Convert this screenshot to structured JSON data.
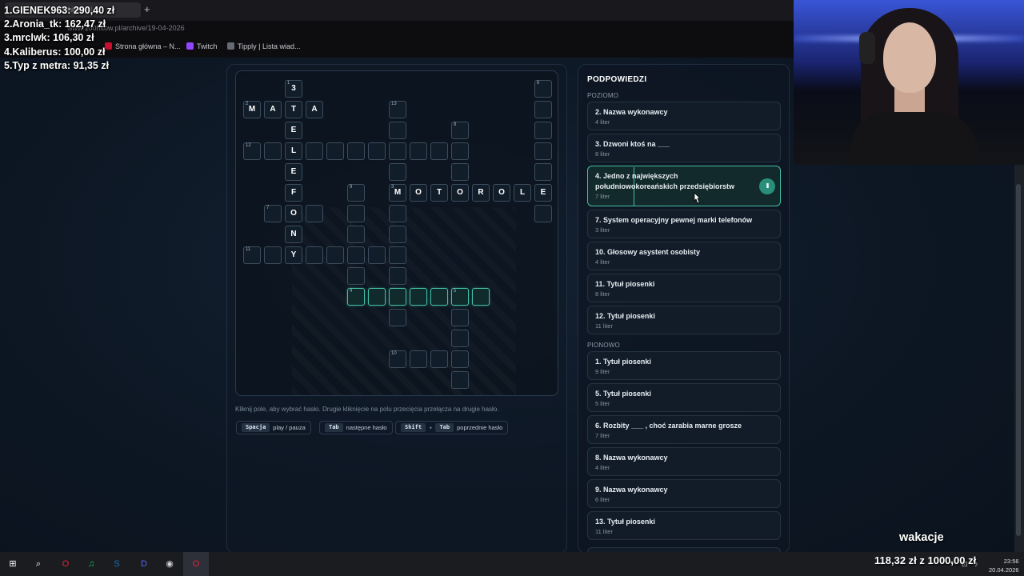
{
  "browser": {
    "tab_title": "100hitów.pl",
    "new_tab": "+",
    "url": "www.100hitow.pl/archive/19-04-2026",
    "bookmarks": [
      {
        "label": "Strona główna – N...",
        "color": "#c8102e"
      },
      {
        "label": "Twitch",
        "color": "#9146ff"
      },
      {
        "label": "Tipply | Lista wiad...",
        "color": "#666a72"
      }
    ]
  },
  "donors": [
    "1.GIENEK963: 290,40 zł",
    "2.Aronia_tk: 162,47 zł",
    "3.mrclwk: 106,30 zł",
    "4.Kaliberus: 100,00 zł",
    "5.Typ z metra: 91,35 zł"
  ],
  "crossword": {
    "help": "Kliknij pole, aby wybrać hasło. Drugie kliknięcie na polu przecięcia przełącza na drugie hasło.",
    "shortcuts": [
      {
        "keys": [
          "Spacja"
        ],
        "desc": "play / pauza"
      },
      {
        "keys": [
          "Tab"
        ],
        "desc": "następne hasło"
      },
      {
        "keys": [
          "Shift",
          "Tab"
        ],
        "desc": "poprzednie hasło"
      }
    ],
    "cells": [
      {
        "r": 0,
        "c": 2,
        "n": "1",
        "l": "3"
      },
      {
        "r": 0,
        "c": 14,
        "n": "6",
        "l": ""
      },
      {
        "r": 1,
        "c": 0,
        "n": "2",
        "l": "M"
      },
      {
        "r": 1,
        "c": 1,
        "n": "",
        "l": "A"
      },
      {
        "r": 1,
        "c": 2,
        "n": "",
        "l": "T"
      },
      {
        "r": 1,
        "c": 3,
        "n": "",
        "l": "A"
      },
      {
        "r": 1,
        "c": 7,
        "n": "13",
        "l": ""
      },
      {
        "r": 1,
        "c": 14,
        "n": "",
        "l": ""
      },
      {
        "r": 2,
        "c": 2,
        "n": "",
        "l": "E"
      },
      {
        "r": 2,
        "c": 7,
        "n": "",
        "l": ""
      },
      {
        "r": 2,
        "c": 10,
        "n": "8",
        "l": ""
      },
      {
        "r": 2,
        "c": 14,
        "n": "",
        "l": ""
      },
      {
        "r": 3,
        "c": 0,
        "n": "12",
        "l": ""
      },
      {
        "r": 3,
        "c": 1,
        "n": "",
        "l": ""
      },
      {
        "r": 3,
        "c": 2,
        "n": "",
        "l": "L"
      },
      {
        "r": 3,
        "c": 3,
        "n": "",
        "l": ""
      },
      {
        "r": 3,
        "c": 4,
        "n": "",
        "l": ""
      },
      {
        "r": 3,
        "c": 5,
        "n": "",
        "l": ""
      },
      {
        "r": 3,
        "c": 6,
        "n": "",
        "l": ""
      },
      {
        "r": 3,
        "c": 7,
        "n": "",
        "l": ""
      },
      {
        "r": 3,
        "c": 8,
        "n": "",
        "l": ""
      },
      {
        "r": 3,
        "c": 9,
        "n": "",
        "l": ""
      },
      {
        "r": 3,
        "c": 10,
        "n": "",
        "l": ""
      },
      {
        "r": 3,
        "c": 14,
        "n": "",
        "l": ""
      },
      {
        "r": 4,
        "c": 2,
        "n": "",
        "l": "E"
      },
      {
        "r": 4,
        "c": 7,
        "n": "",
        "l": ""
      },
      {
        "r": 4,
        "c": 10,
        "n": "",
        "l": ""
      },
      {
        "r": 4,
        "c": 14,
        "n": "",
        "l": ""
      },
      {
        "r": 5,
        "c": 2,
        "n": "",
        "l": "F"
      },
      {
        "r": 5,
        "c": 5,
        "n": "9",
        "l": ""
      },
      {
        "r": 5,
        "c": 7,
        "n": "3",
        "l": "M"
      },
      {
        "r": 5,
        "c": 8,
        "n": "",
        "l": "O"
      },
      {
        "r": 5,
        "c": 9,
        "n": "",
        "l": "T"
      },
      {
        "r": 5,
        "c": 10,
        "n": "",
        "l": "O"
      },
      {
        "r": 5,
        "c": 11,
        "n": "",
        "l": "R"
      },
      {
        "r": 5,
        "c": 12,
        "n": "",
        "l": "O"
      },
      {
        "r": 5,
        "c": 13,
        "n": "",
        "l": "L"
      },
      {
        "r": 5,
        "c": 14,
        "n": "",
        "l": "E"
      },
      {
        "r": 6,
        "c": 1,
        "n": "7",
        "l": ""
      },
      {
        "r": 6,
        "c": 2,
        "n": "",
        "l": "O"
      },
      {
        "r": 6,
        "c": 3,
        "n": "",
        "l": ""
      },
      {
        "r": 6,
        "c": 5,
        "n": "",
        "l": ""
      },
      {
        "r": 6,
        "c": 7,
        "n": "",
        "l": ""
      },
      {
        "r": 6,
        "c": 14,
        "n": "",
        "l": ""
      },
      {
        "r": 7,
        "c": 2,
        "n": "",
        "l": "N"
      },
      {
        "r": 7,
        "c": 5,
        "n": "",
        "l": ""
      },
      {
        "r": 7,
        "c": 7,
        "n": "",
        "l": ""
      },
      {
        "r": 8,
        "c": 0,
        "n": "11",
        "l": ""
      },
      {
        "r": 8,
        "c": 1,
        "n": "",
        "l": ""
      },
      {
        "r": 8,
        "c": 2,
        "n": "",
        "l": "Y"
      },
      {
        "r": 8,
        "c": 3,
        "n": "",
        "l": ""
      },
      {
        "r": 8,
        "c": 4,
        "n": "",
        "l": ""
      },
      {
        "r": 8,
        "c": 5,
        "n": "",
        "l": ""
      },
      {
        "r": 8,
        "c": 6,
        "n": "",
        "l": ""
      },
      {
        "r": 8,
        "c": 7,
        "n": "",
        "l": ""
      },
      {
        "r": 9,
        "c": 5,
        "n": "",
        "l": ""
      },
      {
        "r": 9,
        "c": 7,
        "n": "",
        "l": ""
      },
      {
        "r": 10,
        "c": 5,
        "n": "4",
        "l": "",
        "a": true
      },
      {
        "r": 10,
        "c": 6,
        "n": "",
        "l": "",
        "a": true
      },
      {
        "r": 10,
        "c": 7,
        "n": "",
        "l": "",
        "a": true
      },
      {
        "r": 10,
        "c": 8,
        "n": "",
        "l": "",
        "a": true
      },
      {
        "r": 10,
        "c": 9,
        "n": "",
        "l": "",
        "a": true
      },
      {
        "r": 10,
        "c": 10,
        "n": "5",
        "l": "",
        "a": true
      },
      {
        "r": 10,
        "c": 11,
        "n": "",
        "l": "",
        "a": true
      },
      {
        "r": 11,
        "c": 7,
        "n": "",
        "l": ""
      },
      {
        "r": 11,
        "c": 10,
        "n": "",
        "l": ""
      },
      {
        "r": 12,
        "c": 10,
        "n": "",
        "l": ""
      },
      {
        "r": 13,
        "c": 7,
        "n": "10",
        "l": ""
      },
      {
        "r": 13,
        "c": 8,
        "n": "",
        "l": ""
      },
      {
        "r": 13,
        "c": 9,
        "n": "",
        "l": ""
      },
      {
        "r": 13,
        "c": 10,
        "n": "",
        "l": ""
      },
      {
        "r": 14,
        "c": 10,
        "n": "",
        "l": ""
      }
    ]
  },
  "hints": {
    "title": "PODPOWIEDZI",
    "across_label": "POZIOMO",
    "down_label": "PIONOWO",
    "across": [
      {
        "title": "2. Nazwa wykonawcy",
        "sub": "4 liter"
      },
      {
        "title": "3. Dzwoni ktoś na ___",
        "sub": "8 liter"
      },
      {
        "title": "4. Jedno z największych południowokoreańskich przedsiębiorstw",
        "sub": "7 liter",
        "active": true
      },
      {
        "title": "7. System operacyjny pewnej marki telefonów",
        "sub": "3 liter"
      },
      {
        "title": "10. Głosowy asystent osobisty",
        "sub": "4 liter"
      },
      {
        "title": "11. Tytuł piosenki",
        "sub": "8 liter"
      },
      {
        "title": "12. Tytuł piosenki",
        "sub": "11 liter"
      }
    ],
    "down": [
      {
        "title": "1. Tytuł piosenki",
        "sub": "9 liter"
      },
      {
        "title": "5. Tytuł piosenki",
        "sub": "5 liter"
      },
      {
        "title": "6. Rozbity ___ , choć zarabia marne grosze",
        "sub": "7 liter"
      },
      {
        "title": "8. Nazwa wykonawcy",
        "sub": "4 liter"
      },
      {
        "title": "9. Nazwa wykonawcy",
        "sub": "6 liter"
      },
      {
        "title": "13. Tytuł piosenki",
        "sub": "11 liter"
      }
    ],
    "pause_glyph": "II"
  },
  "overlay": {
    "song": "wakacje",
    "goal": "118,32 zł z 1000,00 zł"
  },
  "taskbar": {
    "time": "23:56",
    "date": "20.04.2026",
    "icons": [
      {
        "name": "windows-start-icon",
        "glyph": "⊞",
        "color": "#ffffff"
      },
      {
        "name": "search-icon",
        "glyph": "⌕",
        "color": "#ffffff"
      },
      {
        "name": "opera-icon",
        "glyph": "O",
        "color": "#e0243a"
      },
      {
        "name": "spotify-icon",
        "glyph": "♫",
        "color": "#1db954"
      },
      {
        "name": "steam-icon",
        "glyph": "S",
        "color": "#1b6fb5"
      },
      {
        "name": "discord-icon",
        "glyph": "D",
        "color": "#5865f2"
      },
      {
        "name": "obs-icon",
        "glyph": "◉",
        "color": "#cfcfcf"
      },
      {
        "name": "opera-gx-icon",
        "glyph": "O",
        "color": "#e0243a"
      }
    ]
  },
  "colors": {
    "accent": "#43c0a6",
    "panel": "#111c28",
    "background": "#0c1520"
  }
}
